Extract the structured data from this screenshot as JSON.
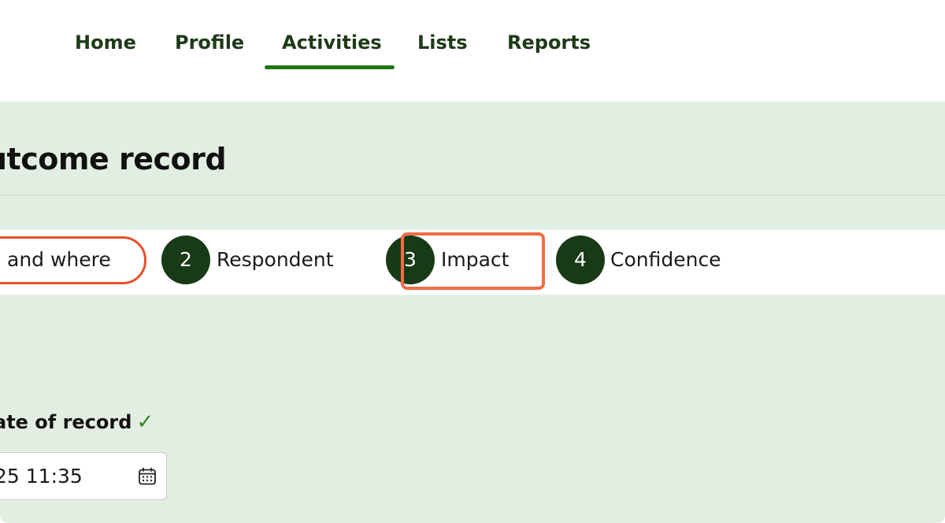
{
  "nav": {
    "items": [
      {
        "label": "Home"
      },
      {
        "label": "Profile"
      },
      {
        "label": "Activities",
        "active": true
      },
      {
        "label": "Lists"
      },
      {
        "label": "Reports"
      }
    ],
    "active_color": "#207514"
  },
  "page": {
    "title": "utcome record"
  },
  "steps": [
    {
      "number": "",
      "label": "and where",
      "active": true
    },
    {
      "number": "2",
      "label": "Respondent"
    },
    {
      "number": "3",
      "label": "Impact",
      "highlighted": true
    },
    {
      "number": "4",
      "label": "Confidence"
    }
  ],
  "date_field": {
    "label": "ate of record",
    "check": "✓",
    "value": "25 11:35",
    "icon": "calendar-icon"
  },
  "colors": {
    "background_green": "#e3eee2",
    "step_circle": "#183a16",
    "active_step_border": "#e8502a",
    "highlight_border": "#f26c45",
    "check": "#2f8a1e"
  }
}
